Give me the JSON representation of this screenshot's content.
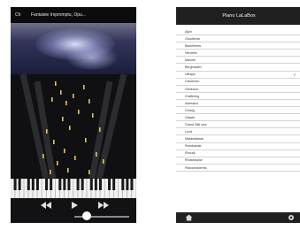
{
  "player": {
    "back_label": "Ch",
    "title": "Fantaisie Impromptu, Opu...",
    "controls": {
      "rewind_icon": "rewind-icon",
      "play_icon": "play-icon",
      "forward_icon": "fast-forward-icon"
    },
    "progress_fraction": 0.22
  },
  "list": {
    "title": "Piano LaLaBox",
    "selected_index": 6,
    "items": [
      "Alpin",
      "Gaudienta",
      "Bachfimers",
      "Nemetto",
      "Manole",
      "Bergmaden",
      "Ultrape",
      "Claverdon",
      "Gierkana",
      "Graftering",
      "Astrealco",
      "Grhbig",
      "Glawte",
      "Grand 288 smc",
      "Lond",
      "Marantataste",
      "Reecharale",
      "Rhoudi",
      "Rhoseacpiw",
      "Pianoexisterms"
    ],
    "bottom_left_icon": "home-icon",
    "bottom_right_icon": "gear-icon"
  },
  "colors": {
    "player_bg": "#0c0c0e",
    "header_bg": "#202020",
    "note_color": "#e2c65a",
    "sky_top": "#6f7088"
  }
}
